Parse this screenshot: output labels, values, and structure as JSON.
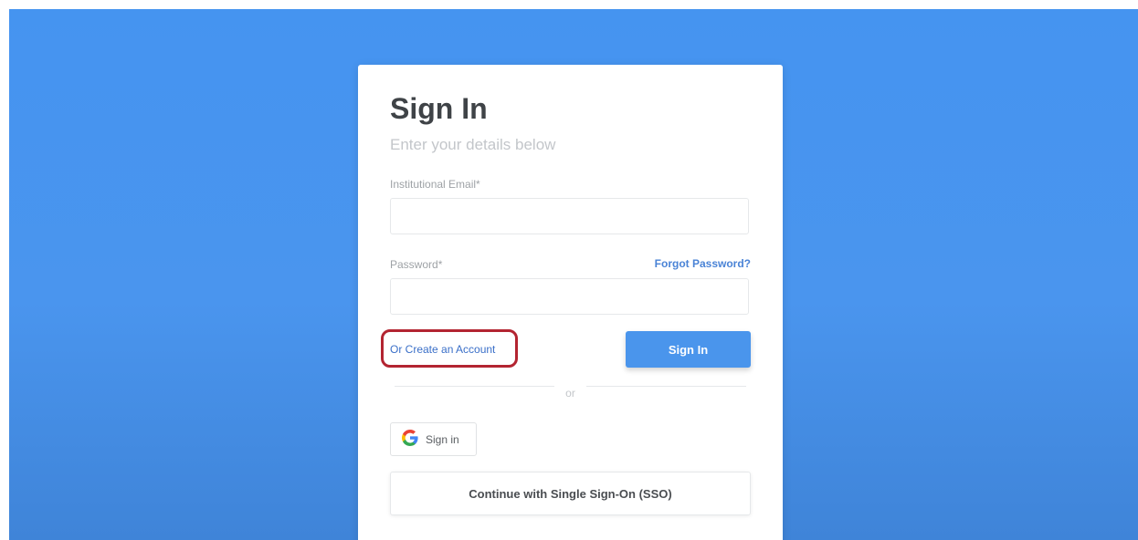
{
  "signin": {
    "title": "Sign In",
    "subtitle": "Enter your details below",
    "email_label": "Institutional Email*",
    "email_value": "",
    "password_label": "Password*",
    "password_value": "",
    "forgot_password": "Forgot Password?",
    "create_account": "Or Create an Account",
    "signin_button": "Sign In",
    "divider_text": "or",
    "google_button": "Sign in",
    "sso_button": "Continue with Single Sign-On (SSO)"
  },
  "icons": {
    "google": "google-g-icon"
  },
  "colors": {
    "background": "#4594f0",
    "primary_button": "#4a95ec",
    "link": "#4a83d6",
    "highlight": "#b32431"
  }
}
